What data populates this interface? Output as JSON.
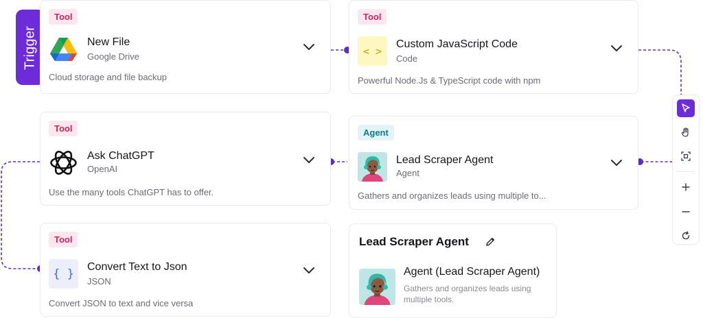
{
  "trigger": {
    "label": "Trigger"
  },
  "nodes": {
    "new_file": {
      "badge": "Tool",
      "title": "New File",
      "subtitle": "Google Drive",
      "description": "Cloud storage and file backup",
      "icon": "google-drive-icon"
    },
    "custom_js": {
      "badge": "Tool",
      "title": "Custom JavaScript Code",
      "subtitle": "Code",
      "description": "Powerful Node.Js & TypeScript code with npm",
      "icon_glyph": "< >",
      "icon": "code-icon"
    },
    "ask_chatgpt": {
      "badge": "Tool",
      "title": "Ask ChatGPT",
      "subtitle": "OpenAI",
      "description": "Use the many tools ChatGPT has to offer.",
      "icon": "openai-icon"
    },
    "lead_scraper": {
      "badge": "Agent",
      "title": "Lead Scraper Agent",
      "subtitle": "Agent",
      "description": "Gathers and organizes leads using multiple to...",
      "icon": "agent-avatar-icon"
    },
    "convert_json": {
      "badge": "Tool",
      "title": "Convert Text to Json",
      "subtitle": "JSON",
      "description": "Convert JSON to text and vice versa",
      "icon_glyph": "{ }",
      "icon": "json-icon"
    }
  },
  "info_panel": {
    "title": "Lead Scraper Agent",
    "agent_name": "Agent (Lead Scraper Agent)",
    "agent_description": "Gathers and organizes leads using multiple tools."
  },
  "toolbar": {
    "items": [
      "select-pointer-icon",
      "hand-pan-icon",
      "fit-view-icon",
      "zoom-in-icon",
      "zoom-out-icon",
      "reset-icon"
    ]
  },
  "colors": {
    "accent": "#6d2bd9",
    "tool_badge_bg": "#fde7ef",
    "tool_badge_text": "#d3245c",
    "agent_badge_bg": "#e2f4f6",
    "agent_badge_text": "#0f7a8a",
    "connector": "#5b2bc9"
  }
}
